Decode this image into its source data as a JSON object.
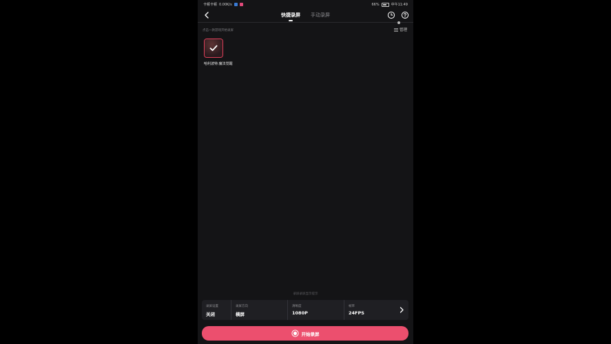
{
  "status_bar": {
    "carrier": "卡顿卡顿",
    "speed": "0.00K/s",
    "battery": "66%",
    "time": "中午11:49"
  },
  "header": {
    "tabs": [
      {
        "label": "快捷录屏",
        "active": true
      },
      {
        "label": "手动录屏",
        "active": false
      }
    ]
  },
  "main": {
    "hint": "点击一款游戏开始录屏",
    "manage_label": "管理",
    "games": [
      {
        "name": "哈利波特:魔法觉醒",
        "selected": true
      }
    ],
    "footer_hint": "录屏录屏显示提示"
  },
  "settings": [
    {
      "label": "录屏设置",
      "value": "关闭"
    },
    {
      "label": "录屏方向",
      "value": "横屏"
    },
    {
      "label": "清晰度",
      "value": "1080P"
    },
    {
      "label": "帧率",
      "value": "24FPS"
    }
  ],
  "start_button": {
    "label": "开始录屏"
  },
  "colors": {
    "accent": "#ec4f6e",
    "background": "#141416",
    "panel": "#1f1f23"
  }
}
